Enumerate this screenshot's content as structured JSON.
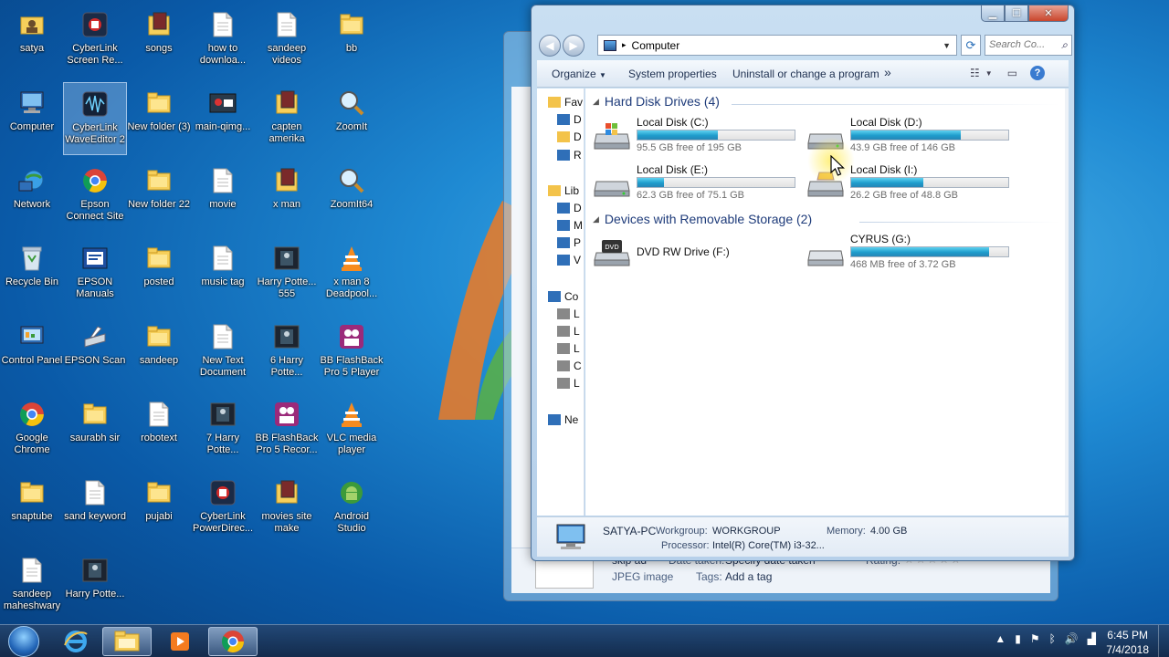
{
  "desktop_icons": [
    {
      "label": "satya",
      "icon": "user-folder-icon"
    },
    {
      "label": "CyberLink Screen Re...",
      "icon": "cyberlink-icon"
    },
    {
      "label": "songs",
      "icon": "media-icon"
    },
    {
      "label": "how to downloa...",
      "icon": "document-icon"
    },
    {
      "label": "sandeep videos",
      "icon": "document-icon"
    },
    {
      "label": "bb",
      "icon": "folder-icon"
    },
    {
      "label": "Computer",
      "icon": "computer-icon"
    },
    {
      "label": "CyberLink WaveEditor 2",
      "icon": "waveeditor-icon"
    },
    {
      "label": "New folder (3)",
      "icon": "folder-icon"
    },
    {
      "label": "main-qimg...",
      "icon": "image-icon"
    },
    {
      "label": "capten amerika",
      "icon": "media-icon"
    },
    {
      "label": "ZoomIt",
      "icon": "zoom-icon"
    },
    {
      "label": "Network",
      "icon": "network-icon"
    },
    {
      "label": "Epson Connect Site",
      "icon": "chrome-icon"
    },
    {
      "label": "New folder 22",
      "icon": "folder-icon"
    },
    {
      "label": "movie",
      "icon": "document-icon"
    },
    {
      "label": "x man",
      "icon": "media-icon"
    },
    {
      "label": "ZoomIt64",
      "icon": "zoom-icon"
    },
    {
      "label": "Recycle Bin",
      "icon": "recycle-bin-icon"
    },
    {
      "label": "EPSON Manuals",
      "icon": "epson-icon"
    },
    {
      "label": "posted",
      "icon": "folder-icon"
    },
    {
      "label": "music tag",
      "icon": "document-icon"
    },
    {
      "label": "Harry Potte... 555",
      "icon": "video-icon"
    },
    {
      "label": "x man 8 Deadpool...",
      "icon": "vlc-icon"
    },
    {
      "label": "Control Panel",
      "icon": "control-panel-icon"
    },
    {
      "label": "EPSON Scan",
      "icon": "scanner-icon"
    },
    {
      "label": "sandeep",
      "icon": "folder-icon"
    },
    {
      "label": "New Text Document",
      "icon": "document-icon"
    },
    {
      "label": "6 Harry Potte...",
      "icon": "video-icon"
    },
    {
      "label": "BB FlashBack Pro 5 Player",
      "icon": "flashback-icon"
    },
    {
      "label": "Google Chrome",
      "icon": "chrome-icon"
    },
    {
      "label": "saurabh sir",
      "icon": "folder-icon"
    },
    {
      "label": "robotext",
      "icon": "document-icon"
    },
    {
      "label": "7 Harry Potte...",
      "icon": "video-icon"
    },
    {
      "label": "BB FlashBack Pro 5 Recor...",
      "icon": "flashback-icon"
    },
    {
      "label": "VLC media player",
      "icon": "vlc-icon"
    },
    {
      "label": "snaptube",
      "icon": "folder-icon"
    },
    {
      "label": "sand keyword",
      "icon": "document-icon"
    },
    {
      "label": "pujabi",
      "icon": "folder-icon"
    },
    {
      "label": "CyberLink PowerDirec...",
      "icon": "cyberlink-icon"
    },
    {
      "label": "movies site make",
      "icon": "media-icon"
    },
    {
      "label": "Android Studio",
      "icon": "android-icon"
    },
    {
      "label": "sandeep maheshwary",
      "icon": "document-icon"
    },
    {
      "label": "Harry Potte...",
      "icon": "video-icon"
    }
  ],
  "back_window": {
    "details": {
      "name": "skip ad",
      "type": "JPEG image",
      "date_label": "Date taken:",
      "date_value": "Specify date taken",
      "tags_label": "Tags:",
      "tags_value": "Add a tag",
      "rating_label": "Rating:"
    }
  },
  "explorer": {
    "address": "Computer",
    "search_placeholder": "Search Co...",
    "toolbar": {
      "organize": "Organize",
      "system_properties": "System properties",
      "uninstall": "Uninstall or change a program",
      "more": "»"
    },
    "nav_items": [
      "Fav",
      "D",
      "D",
      "R",
      "Lib",
      "D",
      "M",
      "P",
      "V",
      "Co",
      "L",
      "L",
      "L",
      "C",
      "L",
      "Ne"
    ],
    "groups": {
      "hard_disk": "Hard Disk Drives (4)",
      "removable": "Devices with Removable Storage (2)"
    },
    "drives": [
      {
        "name": "Local Disk (C:)",
        "free": "95.5 GB free of 195 GB",
        "used_fraction": 0.51
      },
      {
        "name": "Local Disk (D:)",
        "free": "43.9 GB free of 146 GB",
        "used_fraction": 0.7
      },
      {
        "name": "Local Disk (E:)",
        "free": "62.3 GB free of 75.1 GB",
        "used_fraction": 0.17
      },
      {
        "name": "Local Disk (I:)",
        "free": "26.2 GB free of 48.8 GB",
        "used_fraction": 0.46
      }
    ],
    "removable": [
      {
        "name": "DVD RW Drive (F:)"
      },
      {
        "name": "CYRUS (G:)",
        "free": "468 MB free of 3.72 GB",
        "used_fraction": 0.88
      }
    ],
    "details_pane": {
      "pc_name": "SATYA-PC",
      "workgroup_label": "Workgroup:",
      "workgroup_value": "WORKGROUP",
      "memory_label": "Memory:",
      "memory_value": "4.00 GB",
      "processor_label": "Processor:",
      "processor_value": "Intel(R) Core(TM) i3-32..."
    }
  },
  "taskbar": {
    "time": "6:45 PM",
    "date": "7/4/2018"
  },
  "colors": {
    "accent": "#1e9ccc",
    "group_header": "#1e3b7a"
  }
}
